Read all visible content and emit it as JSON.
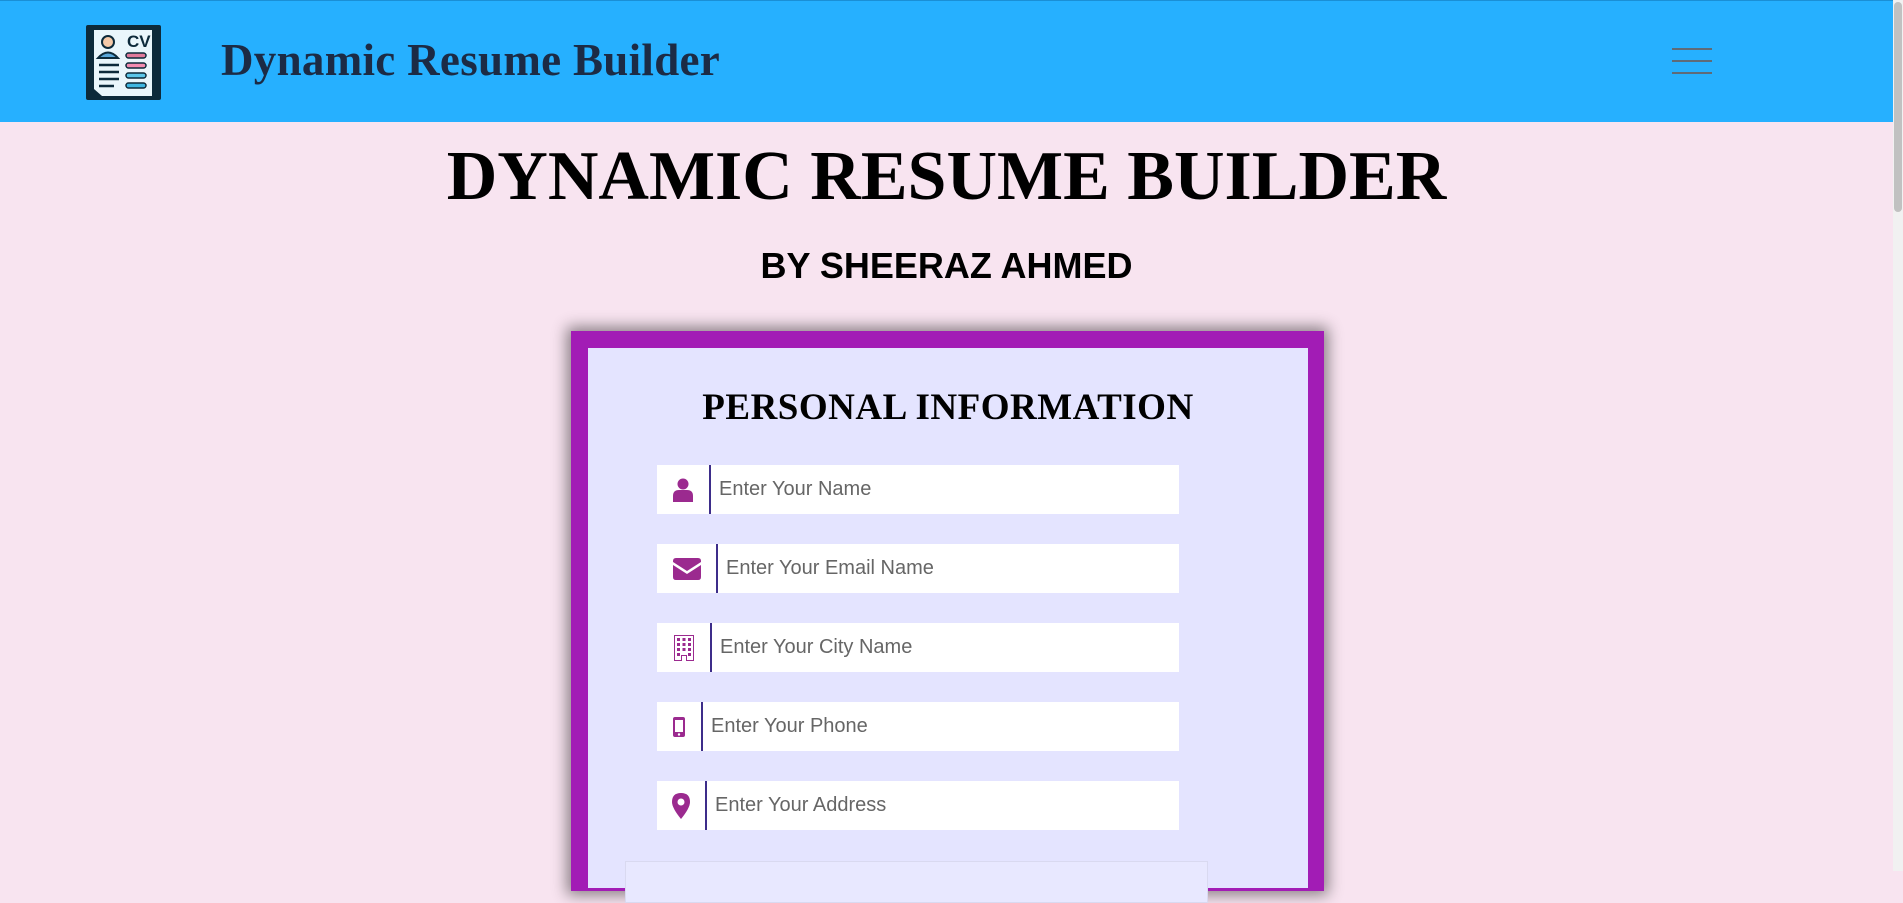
{
  "navbar": {
    "brand": "Dynamic Resume Builder",
    "logo_icon": "cv-document-icon",
    "menu_icon": "hamburger-menu-icon",
    "bg_color": "#26b0ff"
  },
  "header": {
    "title": "DYNAMIC RESUME BUILDER",
    "subtitle": "BY SHEERAZ AHMED"
  },
  "form": {
    "section_title": "PERSONAL INFORMATION",
    "frame_color": "#a21cb5",
    "fields": [
      {
        "icon": "user-icon",
        "placeholder": "Enter Your Name",
        "value": ""
      },
      {
        "icon": "envelope-icon",
        "placeholder": "Enter Your Email Name",
        "value": ""
      },
      {
        "icon": "building-icon",
        "placeholder": "Enter Your City Name",
        "value": ""
      },
      {
        "icon": "mobile-phone-icon",
        "placeholder": "Enter Your Phone",
        "value": ""
      },
      {
        "icon": "map-marker-icon",
        "placeholder": "Enter Your Address",
        "value": ""
      }
    ]
  }
}
